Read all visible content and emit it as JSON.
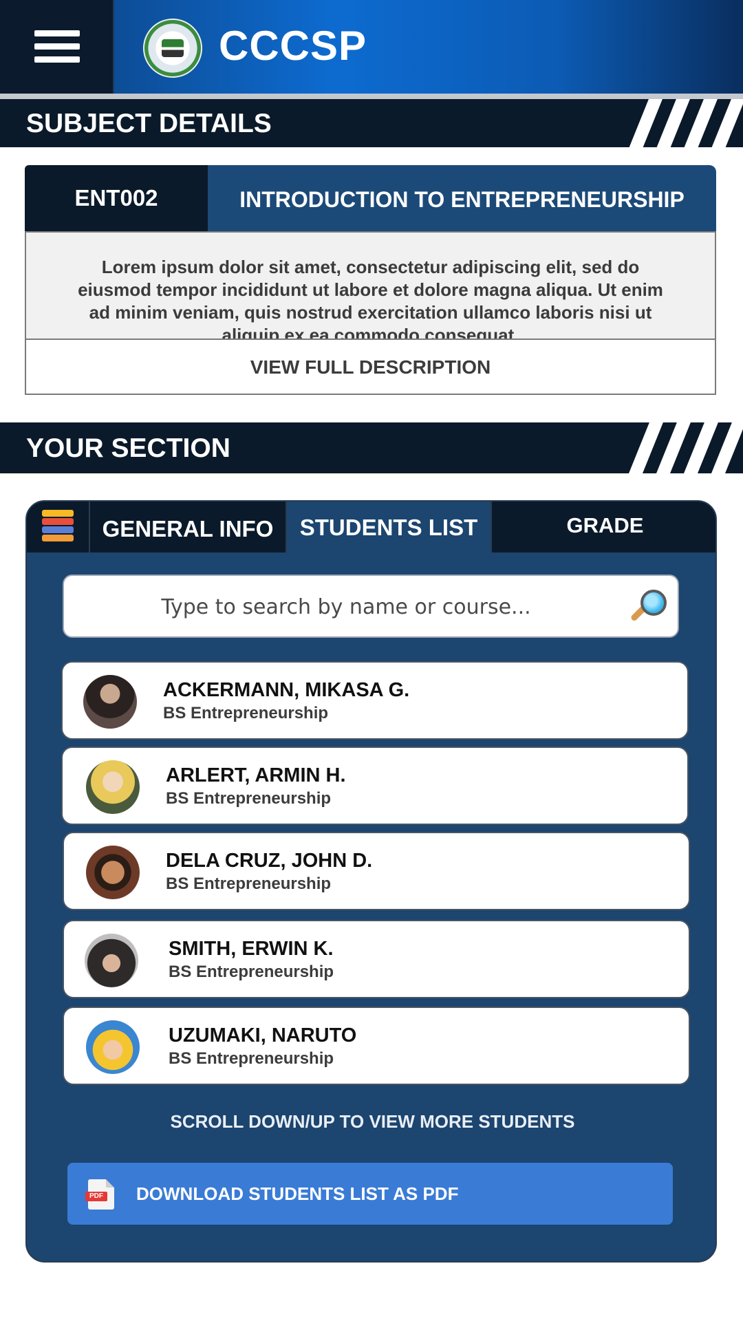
{
  "header": {
    "app_title": "CCCSP"
  },
  "subject_section": {
    "title": "SUBJECT DETAILS",
    "code": "ENT002",
    "name": "INTRODUCTION TO ENTREPRENEURSHIP",
    "description": "Lorem ipsum dolor sit amet, consectetur adipiscing elit, sed do eiusmod tempor incididunt ut labore et dolore magna aliqua. Ut enim ad minim veniam, quis nostrud exercitation ullamco laboris nisi ut aliquip ex ea commodo consequat.",
    "view_button": "VIEW FULL DESCRIPTION"
  },
  "your_section": {
    "title": "YOUR SECTION",
    "tabs": [
      {
        "label": "GENERAL INFO"
      },
      {
        "label": "STUDENTS LIST"
      },
      {
        "label": "GRADE"
      }
    ],
    "search": {
      "placeholder": "Type to search by name or course..."
    },
    "students": [
      {
        "name": "ACKERMANN, MIKASA G.",
        "course": "BS Entrepreneurship"
      },
      {
        "name": "ARLERT, ARMIN H.",
        "course": "BS Entrepreneurship"
      },
      {
        "name": "DELA CRUZ, JOHN D.",
        "course": "BS Entrepreneurship"
      },
      {
        "name": "SMITH, ERWIN K.",
        "course": "BS Entrepreneurship"
      },
      {
        "name": "UZUMAKI, NARUTO",
        "course": "BS Entrepreneurship"
      }
    ],
    "scroll_hint": "SCROLL DOWN/UP TO VIEW MORE STUDENTS",
    "download_button": "DOWNLOAD STUDENTS LIST AS PDF",
    "pdf_icon_text": "PDF"
  },
  "colors": {
    "header_gradient": "#0d6bd0",
    "dark_navy": "#0b1a2a",
    "panel_blue": "#1c456f",
    "download_blue": "#3a7bd5"
  },
  "icons": [
    "menu-icon",
    "college-logo",
    "books-icon",
    "search-icon",
    "pdf-icon"
  ]
}
